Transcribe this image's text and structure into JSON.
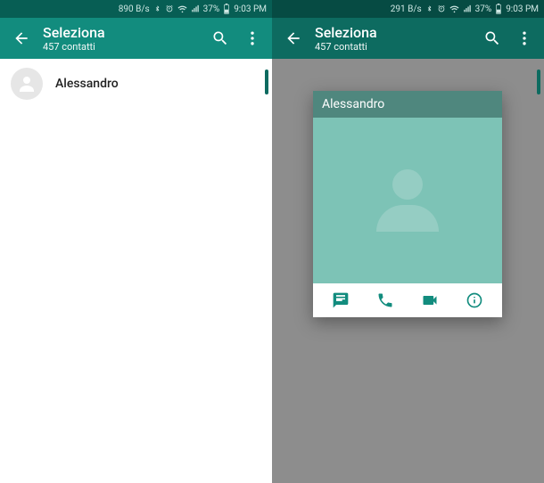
{
  "left": {
    "status": {
      "bandwidth": "890 B/s",
      "battery": "37%",
      "time": "9:03 PM"
    },
    "appbar": {
      "title": "Seleziona",
      "subtitle": "457 contatti"
    },
    "contact": {
      "name": "Alessandro"
    }
  },
  "right": {
    "status": {
      "bandwidth": "291 B/s",
      "battery": "37%",
      "time": "9:03 PM"
    },
    "appbar": {
      "title": "Seleziona",
      "subtitle": "457 contatti"
    },
    "card": {
      "name": "Alessandro"
    }
  },
  "colors": {
    "primary": "#128C7E",
    "primaryDark": "#075E54",
    "overlay": "#8d8d8d",
    "avatarBg": "#7dc3b6"
  }
}
